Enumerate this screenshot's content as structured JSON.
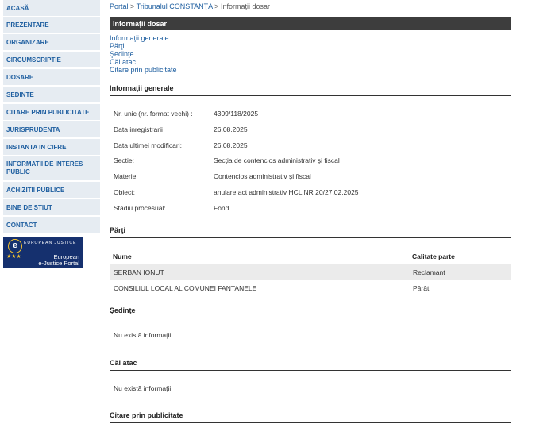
{
  "sidebar": {
    "items": [
      {
        "label": "ACASĂ"
      },
      {
        "label": "PREZENTARE"
      },
      {
        "label": "ORGANIZARE"
      },
      {
        "label": "CIRCUMSCRIPTIE"
      },
      {
        "label": "DOSARE"
      },
      {
        "label": "SEDINTE"
      },
      {
        "label": "CITARE PRIN PUBLICITATE"
      },
      {
        "label": "JURISPRUDENTA"
      },
      {
        "label": "INSTANTA IN CIFRE"
      },
      {
        "label": "INFORMATII DE INTERES PUBLIC"
      },
      {
        "label": "ACHIZITII PUBLICE"
      },
      {
        "label": "BINE DE STIUT"
      },
      {
        "label": "CONTACT"
      }
    ],
    "banner": {
      "brand_top": "EUROPEAN JUSTICE",
      "line1": "European",
      "line2": "e-Justice Portal"
    }
  },
  "breadcrumb": {
    "portal": "Portal",
    "court": "Tribunalul CONSTANŢA",
    "current": "Informaţii dosar",
    "sep": ">"
  },
  "header": {
    "title": "Informaţii dosar"
  },
  "section_links": [
    "Informaţii generale",
    "Părţi",
    "Şedinţe",
    "Căi atac",
    "Citare prin publicitate"
  ],
  "general": {
    "heading": "Informaţii generale",
    "rows": [
      {
        "label": "Nr. unic (nr. format vechi) :",
        "value": "4309/118/2025"
      },
      {
        "label": "Data inregistrarii",
        "value": "26.08.2025"
      },
      {
        "label": "Data ultimei modificari:",
        "value": "26.08.2025"
      },
      {
        "label": "Sectie:",
        "value": "Secţia de contencios administrativ şi fiscal"
      },
      {
        "label": "Materie:",
        "value": "Contencios administrativ şi fiscal"
      },
      {
        "label": "Obiect:",
        "value": "anulare act administrativ HCL NR 20/27.02.2025"
      },
      {
        "label": "Stadiu procesual:",
        "value": "Fond"
      }
    ]
  },
  "parti": {
    "heading": "Părţi",
    "col_name": "Nume",
    "col_role": "Calitate parte",
    "rows": [
      {
        "name": "SERBAN IONUT",
        "role": "Reclamant"
      },
      {
        "name": "CONSILIUL LOCAL AL COMUNEI FANTANELE",
        "role": "Pârât"
      }
    ]
  },
  "sedinte": {
    "heading": "Şedinţe",
    "empty": "Nu există informaţii."
  },
  "cai_atac": {
    "heading": "Căi atac",
    "empty": "Nu există informaţii."
  },
  "citare": {
    "heading": "Citare prin publicitate"
  }
}
